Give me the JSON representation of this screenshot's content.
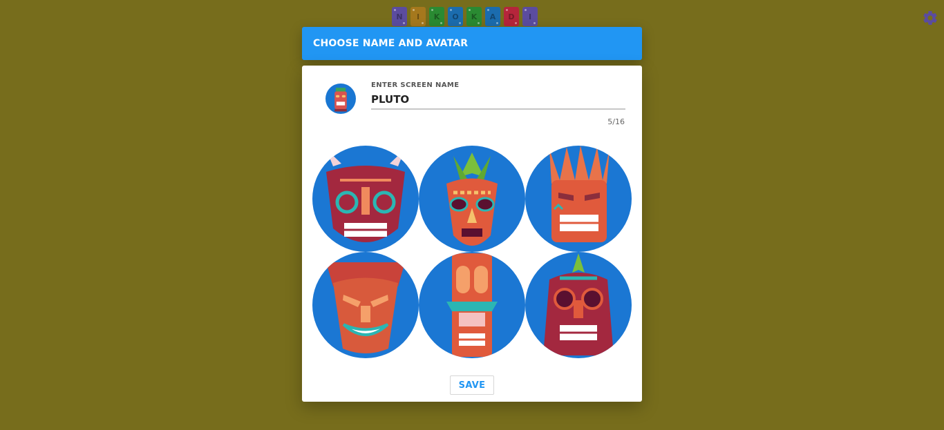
{
  "logo": {
    "letters": [
      "N",
      "I",
      "K",
      "O",
      "K",
      "A",
      "D",
      "I"
    ],
    "colors": [
      "#5b4c9f",
      "#a5781d",
      "#2a8a32",
      "#1b6cae",
      "#2a8a32",
      "#1b6cae",
      "#b5253b",
      "#5b4c9f"
    ]
  },
  "settings": {
    "icon": "gear-icon",
    "color": "#5b4c9f"
  },
  "dialog": {
    "title": "CHOOSE NAME AND AVATAR",
    "header_color": "#2196f3",
    "name_label": "ENTER SCREEN NAME",
    "name_value": "PLUTO",
    "char_count": "5/16",
    "save_label": "SAVE"
  },
  "avatars": [
    {
      "name": "horned-tiki-mask",
      "selected": false
    },
    {
      "name": "leafy-tiki-mask",
      "selected": false
    },
    {
      "name": "feather-tiki-mask",
      "selected": false
    },
    {
      "name": "angry-tiki-mask",
      "selected": false
    },
    {
      "name": "totem-tiki-mask",
      "selected": true
    },
    {
      "name": "round-eyed-tiki-mask",
      "selected": false
    }
  ]
}
